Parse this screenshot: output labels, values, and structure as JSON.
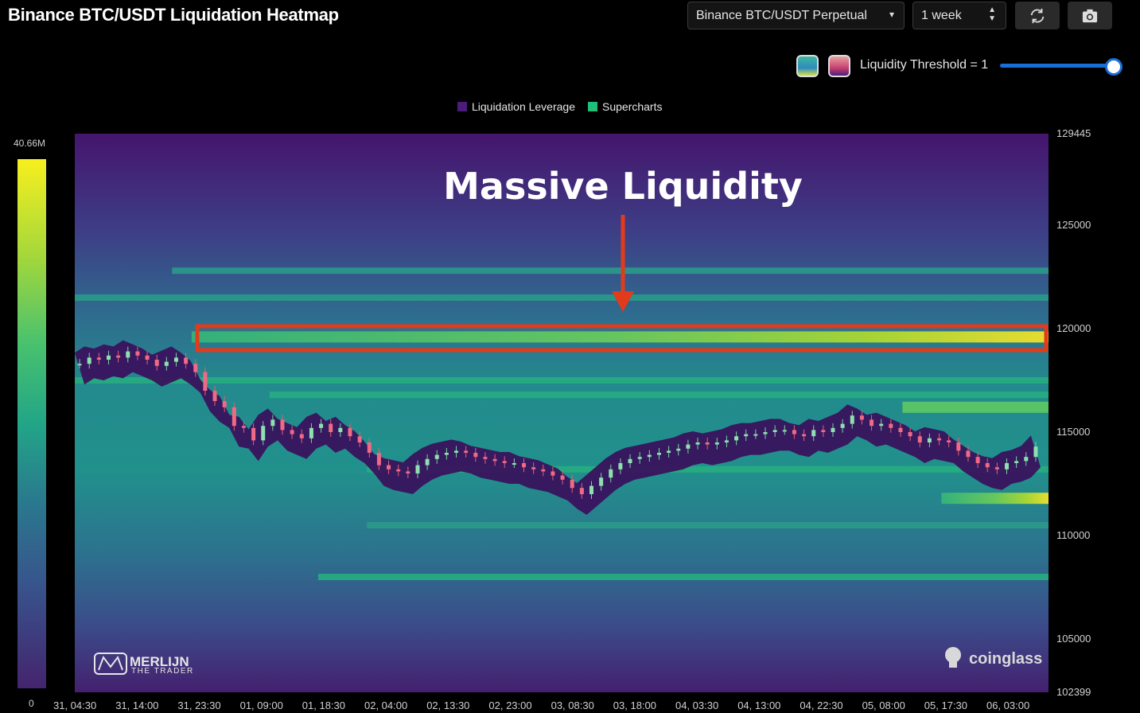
{
  "header": {
    "title": "Binance BTC/USDT Liquidation Heatmap",
    "pair_select": "Binance BTC/USDT Perpetual",
    "range_select": "1 week",
    "refresh_icon": "refresh-icon",
    "camera_icon": "camera-icon"
  },
  "controls": {
    "threshold_label": "Liquidity Threshold = 1",
    "threshold_value": 1,
    "swatch_colors": [
      "#2fb47c",
      "#c94070"
    ]
  },
  "legend": [
    {
      "label": "Liquidation Leverage",
      "color": "#4b1c7a"
    },
    {
      "label": "Supercharts",
      "color": "#1fbf7a"
    }
  ],
  "colorscale": {
    "max_label": "40.66M",
    "min_label": "0"
  },
  "annotation": {
    "text": "Massive Liquidity"
  },
  "watermarks": {
    "left": "MERLIJN THE TRADER",
    "right": "coinglass"
  },
  "chart_data": {
    "type": "heatmap",
    "title": "Binance BTC/USDT Liquidation Heatmap",
    "y_ticks": [
      129445,
      125000,
      120000,
      115000,
      110000,
      105000,
      102399
    ],
    "ylim": [
      102399,
      129445
    ],
    "x_ticks": [
      "31, 04:30",
      "31, 14:00",
      "31, 23:30",
      "01, 09:00",
      "01, 18:30",
      "02, 04:00",
      "02, 13:30",
      "02, 23:00",
      "03, 08:30",
      "03, 18:00",
      "04, 03:30",
      "04, 13:00",
      "04, 22:30",
      "05, 08:00",
      "05, 17:30",
      "06, 03:00"
    ],
    "colorscale_range": [
      0,
      "40.66M"
    ],
    "highlight_level": 119600,
    "liquidity_bands": [
      {
        "price": 119600,
        "intensity": 0.95,
        "start": 0.12
      },
      {
        "price": 116200,
        "intensity": 0.85,
        "start": 0.85
      },
      {
        "price": 111800,
        "intensity": 0.9,
        "start": 0.89
      },
      {
        "price": 117500,
        "intensity": 0.55,
        "start": 0.0
      },
      {
        "price": 116800,
        "intensity": 0.5,
        "start": 0.2
      },
      {
        "price": 113200,
        "intensity": 0.5,
        "start": 0.3
      },
      {
        "price": 110500,
        "intensity": 0.45,
        "start": 0.3
      },
      {
        "price": 108000,
        "intensity": 0.5,
        "start": 0.25
      },
      {
        "price": 121500,
        "intensity": 0.4,
        "start": 0.0
      },
      {
        "price": 122800,
        "intensity": 0.35,
        "start": 0.1
      }
    ],
    "price_series": [
      118300,
      118600,
      118500,
      118700,
      118600,
      118900,
      118700,
      118500,
      118200,
      118400,
      118600,
      118300,
      117900,
      117000,
      116500,
      116200,
      115300,
      115200,
      114600,
      115300,
      115600,
      115100,
      114900,
      114700,
      115200,
      115400,
      115000,
      115200,
      114800,
      114500,
      114000,
      113400,
      113200,
      113100,
      113000,
      113400,
      113700,
      113900,
      114000,
      114100,
      114000,
      113800,
      113700,
      113600,
      113500,
      113500,
      113300,
      113200,
      113100,
      112900,
      112700,
      112300,
      112000,
      112400,
      112800,
      113200,
      113500,
      113700,
      113800,
      113900,
      114000,
      114100,
      114200,
      114400,
      114500,
      114400,
      114500,
      114600,
      114800,
      114900,
      114900,
      115000,
      115100,
      115100,
      114900,
      114800,
      115100,
      115000,
      115200,
      115400,
      115800,
      115600,
      115300,
      115400,
      115200,
      115000,
      114800,
      114500,
      114700,
      114600,
      114500,
      114100,
      113800,
      113500,
      113300,
      113200,
      113500,
      113600,
      113800,
      114300
    ]
  }
}
